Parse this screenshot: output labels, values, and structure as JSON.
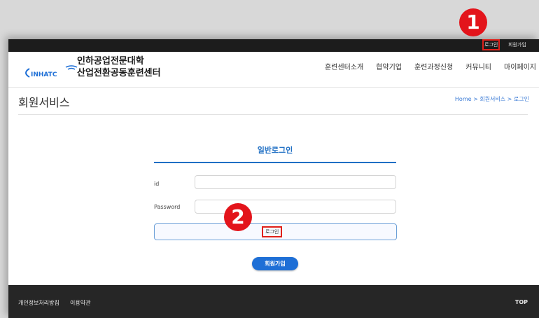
{
  "topbar": {
    "login": "로그인",
    "join": "회원가입"
  },
  "header": {
    "logo_name_line1": "인하공업전문대학",
    "logo_name_line2": "산업전환공동훈련센터",
    "logo_mark_text": "INHATC",
    "menu": [
      "훈련센터소개",
      "협약기업",
      "훈련과정신청",
      "커뮤니티",
      "마이페이지"
    ]
  },
  "page": {
    "title": "회원서비스",
    "breadcrumb": "Home > 회원서비스 > 로그인"
  },
  "login": {
    "title": "일반로그인",
    "id_label": "id",
    "password_label": "Password",
    "submit_label": "로그인",
    "join_button": "회원가입"
  },
  "footer": {
    "privacy": "개인정보처리방침",
    "terms": "이용약관",
    "top": "TOP"
  },
  "badges": {
    "one": "1",
    "two": "2"
  },
  "colors": {
    "accent": "#1f6fc4",
    "highlight": "#e0201a",
    "footer": "#262626"
  }
}
